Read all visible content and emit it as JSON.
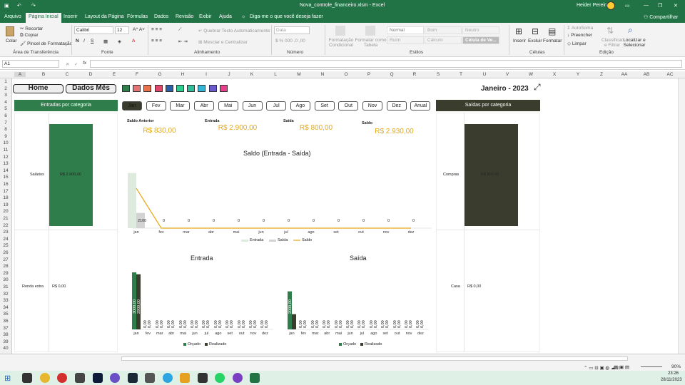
{
  "titlebar": {
    "filename": "Nova_controle_financeiro.xlsm - Excel",
    "user": "Heider Pereira"
  },
  "tabs": [
    "Arquivo",
    "Página Inicial",
    "Inserir",
    "Layout da Página",
    "Fórmulas",
    "Dados",
    "Revisão",
    "Exibir",
    "Ajuda",
    "Diga-me o que você deseja fazer"
  ],
  "share": "Compartilhar",
  "ribbon": {
    "colar": "Colar",
    "recortar": "Recortar",
    "copiar": "Copiar",
    "pincel": "Pincel de Formatação",
    "font_name": "Calibri",
    "font_size": "12",
    "wrap": "Quebrar Texto Automaticamente",
    "merge": "Mesclar e Centralizar",
    "numfmt": "Data",
    "cond": "Formatação Condicional",
    "astable": "Formatar como Tabela",
    "styles": [
      "Normal",
      "Bom",
      "Neutro",
      "Ruim",
      "Cálculo",
      "Célula de Ve..."
    ],
    "inserir": "Inserir",
    "excluir": "Excluir",
    "formatar": "Formatar",
    "autosoma": "AutoSoma",
    "preencher": "Preencher",
    "limpar": "Limpar",
    "classificar": "Classificar e Filtrar",
    "localizar": "Localizar e Selecionar",
    "groups": [
      "Área de Transferência",
      "Fonte",
      "Alinhamento",
      "Número",
      "Estilos",
      "Células",
      "Edição"
    ]
  },
  "name_box": "A1",
  "fx": "fx",
  "columns": [
    "A",
    "B",
    "C",
    "D",
    "E",
    "F",
    "G",
    "H",
    "I",
    "J",
    "K",
    "L",
    "M",
    "N",
    "O",
    "P",
    "Q",
    "R",
    "S",
    "T",
    "U",
    "V",
    "W",
    "X",
    "Y",
    "Z",
    "AA",
    "AB",
    "AC"
  ],
  "rows": [
    "1",
    "2",
    "3",
    "4",
    "5",
    "6",
    "7",
    "8",
    "9",
    "10",
    "11",
    "12",
    "13",
    "14",
    "15",
    "16",
    "17",
    "18",
    "19",
    "20",
    "21",
    "22",
    "23",
    "24",
    "25",
    "26",
    "27",
    "28",
    "29",
    "30",
    "31",
    "32",
    "33",
    "34",
    "35",
    "36",
    "37",
    "38",
    "39",
    "40"
  ],
  "dashboard": {
    "home": "Home",
    "dados_mes": "Dados Mês",
    "period": "Janeiro - 2023",
    "swatches": [
      "#2e7d4a",
      "#e57373",
      "#e8734a",
      "#e0486b",
      "#2a5fa8",
      "#2ecc8e",
      "#2ebf9a",
      "#35b5d6",
      "#6a5acd",
      "#e83e8c"
    ],
    "months": [
      "Jan",
      "Fev",
      "Mar",
      "Abr",
      "Mai",
      "Jun",
      "Jul",
      "Ago",
      "Set",
      "Out",
      "Nov",
      "Dez",
      "Anual"
    ],
    "selected_month": "Jan",
    "entradas_title": "Entradas por categoria",
    "saidas_title": "Saídas por categoria",
    "entradas": [
      {
        "cat": "Salários",
        "value": "R$ 2.900,00"
      },
      {
        "cat": "Renda extra",
        "value": "R$ 0,00"
      }
    ],
    "saidas": [
      {
        "cat": "Compras",
        "value": "R$ 800,00"
      },
      {
        "cat": "Casa",
        "value": "R$ 0,00"
      }
    ],
    "cards": [
      {
        "label": "Saldo Anterior",
        "value": "R$ 830,00"
      },
      {
        "label": "Entrada",
        "value": "R$ 2.900,00"
      },
      {
        "label": "Saída",
        "value": "R$ 800,00"
      },
      {
        "label": "Saldo",
        "value": "R$ 2.930,00"
      }
    ],
    "green": "#2e7d4a",
    "dark": "#3a3d2e",
    "gold": "#e6a817"
  },
  "chart_data": [
    {
      "type": "bar",
      "title": "Saldo  (Entrada - Saída)",
      "categories": [
        "jan",
        "fev",
        "mar",
        "abr",
        "mai",
        "jun",
        "jul",
        "ago",
        "set",
        "out",
        "nov",
        "dez"
      ],
      "series": [
        {
          "name": "Entrada",
          "values": [
            2900,
            0,
            0,
            0,
            0,
            0,
            0,
            0,
            0,
            0,
            0,
            0
          ]
        },
        {
          "name": "Saída",
          "values": [
            800,
            0,
            0,
            0,
            0,
            0,
            0,
            0,
            0,
            0,
            0,
            0
          ]
        },
        {
          "name": "Saldo",
          "values": [
            2100,
            0,
            0,
            0,
            0,
            0,
            0,
            0,
            0,
            0,
            0,
            0
          ]
        }
      ],
      "data_labels": [
        "2100",
        "0",
        "0",
        "0",
        "0",
        "0",
        "0",
        "0",
        "0",
        "0",
        "0",
        "0"
      ]
    },
    {
      "type": "bar",
      "title": "Entrada",
      "categories": [
        "jan",
        "fev",
        "mar",
        "abr",
        "mai",
        "jun",
        "jul",
        "ago",
        "set",
        "out",
        "nov",
        "dez"
      ],
      "series": [
        {
          "name": "Orçado",
          "values": [
            3000,
            0,
            0,
            0,
            0,
            0,
            0,
            0,
            0,
            0,
            0,
            0
          ]
        },
        {
          "name": "Realizado",
          "values": [
            2900,
            0,
            0,
            0,
            0,
            0,
            0,
            0,
            0,
            0,
            0,
            0
          ]
        }
      ],
      "data_labels": [
        "3000,00",
        "2900,00"
      ]
    },
    {
      "type": "bar",
      "title": "Saída",
      "categories": [
        "jan",
        "fev",
        "mar",
        "abr",
        "mai",
        "jun",
        "jul",
        "ago",
        "set",
        "out",
        "nov",
        "dez"
      ],
      "series": [
        {
          "name": "Orçado",
          "values": [
            2000,
            0,
            0,
            0,
            0,
            0,
            0,
            0,
            0,
            0,
            0,
            0
          ]
        },
        {
          "name": "Realizado",
          "values": [
            800,
            0,
            0,
            0,
            0,
            0,
            0,
            0,
            0,
            0,
            0,
            0
          ]
        }
      ],
      "data_labels": [
        "2000,00",
        "800,00"
      ]
    }
  ],
  "zero_label": "0,00",
  "status": {
    "zoom": "90%"
  },
  "taskbar": {
    "time": "23:26",
    "date": "28/11/2023"
  }
}
